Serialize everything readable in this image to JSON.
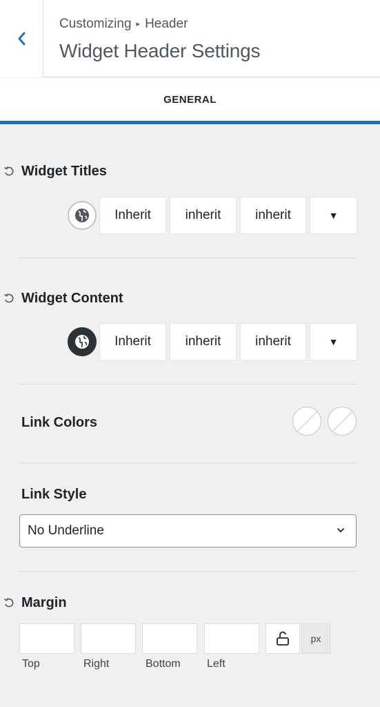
{
  "header": {
    "breadcrumb_parent": "Customizing",
    "breadcrumb_separator": "▸",
    "breadcrumb_current": "Header",
    "title": "Widget Header Settings"
  },
  "tabs": [
    {
      "label": "GENERAL",
      "active": true
    }
  ],
  "widget_titles": {
    "label": "Widget Titles",
    "font_family": "Inherit",
    "font_weight": "inherit",
    "font_style": "inherit",
    "dropdown_icon": "▼"
  },
  "widget_content": {
    "label": "Widget Content",
    "font_family": "Inherit",
    "font_weight": "inherit",
    "font_style": "inherit",
    "dropdown_icon": "▼"
  },
  "link_colors": {
    "label": "Link Colors"
  },
  "link_style": {
    "label": "Link Style",
    "selected": "No Underline"
  },
  "margin": {
    "label": "Margin",
    "fields": [
      {
        "label": "Top",
        "value": ""
      },
      {
        "label": "Right",
        "value": ""
      },
      {
        "label": "Bottom",
        "value": ""
      },
      {
        "label": "Left",
        "value": ""
      }
    ],
    "unit": "px"
  },
  "colors": {
    "accent": "#1e73be",
    "text": "#1d2327",
    "muted": "#50575e",
    "background": "#f0f0f1"
  }
}
